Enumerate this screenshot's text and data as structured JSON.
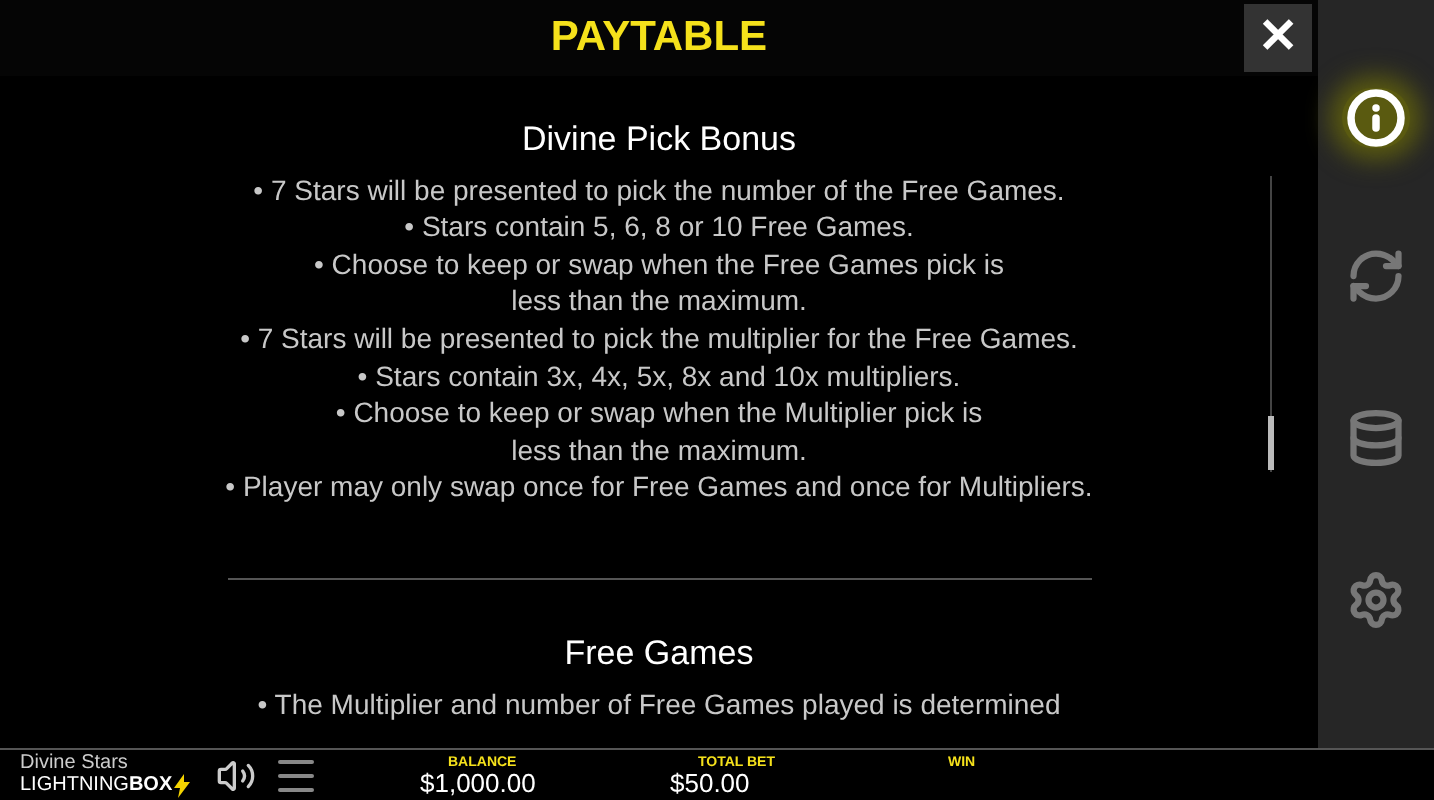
{
  "header": {
    "title": "PAYTABLE",
    "close": "✕"
  },
  "sections": [
    {
      "title": "Divine Pick Bonus",
      "lines": [
        "• 7 Stars will be presented to pick the number of the Free Games.",
        "• Stars contain 5, 6, 8 or 10 Free Games.",
        "• Choose to keep or swap when the Free Games pick is",
        "less than the maximum.",
        "• 7 Stars will be presented to pick the multiplier for the Free Games.",
        "• Stars contain 3x, 4x, 5x, 8x and 10x multipliers.",
        "• Choose to keep or swap when the Multiplier pick is",
        "less than the maximum.",
        "• Player may only swap once for Free Games and once for Multipliers."
      ]
    },
    {
      "title": "Free Games",
      "lines": [
        "• The Multiplier and number of Free Games played is determined"
      ]
    }
  ],
  "sidebar": [
    {
      "kind": "info",
      "selected": true
    },
    {
      "kind": "autoplay",
      "selected": false
    },
    {
      "kind": "bet",
      "selected": false
    },
    {
      "kind": "settings",
      "selected": false
    }
  ],
  "footer": {
    "game": "Divine Stars",
    "brand": "LIGHTNING",
    "brand_bold": "BOX",
    "meters": [
      {
        "label": "BALANCE",
        "value": "$1,000.00"
      },
      {
        "label": "TOTAL BET",
        "value": "$50.00"
      },
      {
        "label": "WIN"
      }
    ]
  }
}
